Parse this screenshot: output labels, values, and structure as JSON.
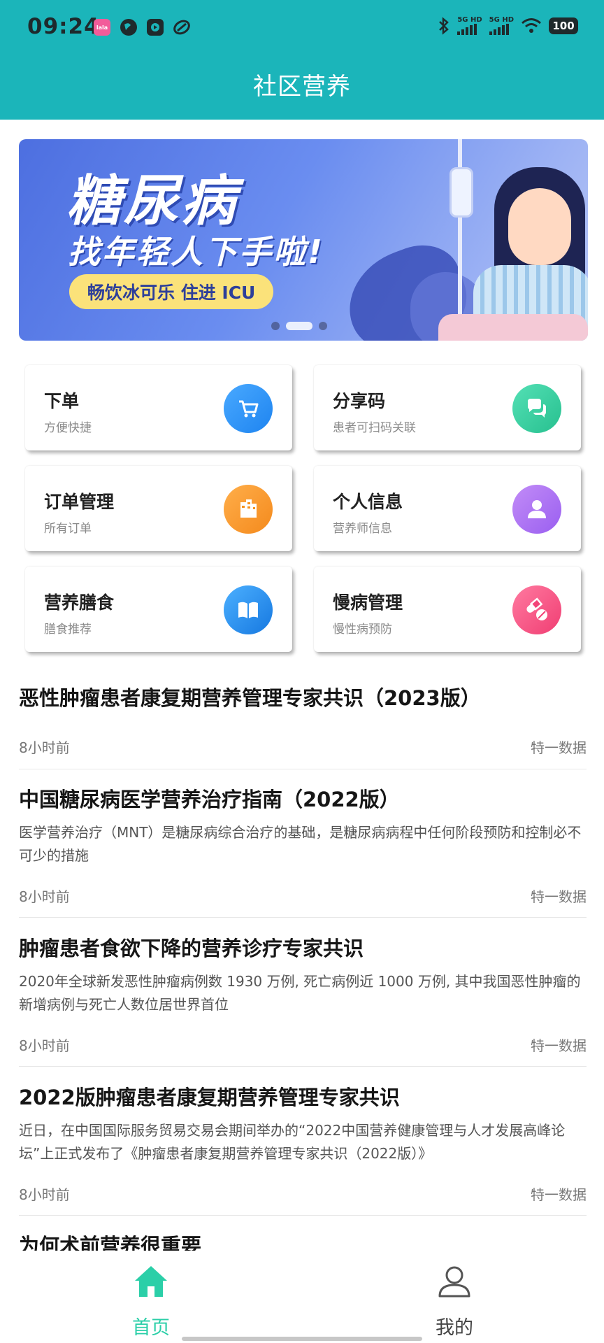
{
  "status_bar": {
    "time": "09:24",
    "app_icons": [
      "lala-app-icon",
      "globe-app-icon",
      "video-app-icon",
      "leaf-app-icon"
    ],
    "network_1": "5G HD",
    "network_2": "5G HD",
    "battery": "100"
  },
  "header": {
    "title": "社区营养",
    "background_color": "#1BB5BA"
  },
  "banner": {
    "title": "糖尿病",
    "subtitle": "找年轻人下手啦!",
    "pill": "畅饮冰可乐 住进 ICU",
    "active_dot_index": 1,
    "dot_count": 3
  },
  "grid": [
    {
      "title": "下单",
      "subtitle": "方便快捷",
      "icon": "cart-icon",
      "color": "#2A8CF3"
    },
    {
      "title": "分享码",
      "subtitle": "患者可扫码关联",
      "icon": "chat-bubbles-icon",
      "color": "#2DC495"
    },
    {
      "title": "订单管理",
      "subtitle": "所有订单",
      "icon": "building-icon",
      "color": "#F5921F"
    },
    {
      "title": "个人信息",
      "subtitle": "营养师信息",
      "icon": "person-icon",
      "color": "#A066F1"
    },
    {
      "title": "营养膳食",
      "subtitle": "膳食推荐",
      "icon": "book-icon",
      "color": "#1D82E6"
    },
    {
      "title": "慢病管理",
      "subtitle": "慢性病预防",
      "icon": "pill-icon",
      "color": "#F24478"
    }
  ],
  "news": [
    {
      "title": "恶性肿瘤患者康复期营养管理专家共识（2023版）",
      "desc": "",
      "time": "8小时前",
      "source": "特一数据"
    },
    {
      "title": "中国糖尿病医学营养治疗指南（2022版）",
      "desc": "医学营养治疗（MNT）是糖尿病综合治疗的基础，是糖尿病病程中任何阶段预防和控制必不可少的措施",
      "time": "8小时前",
      "source": "特一数据"
    },
    {
      "title": "肿瘤患者食欲下降的营养诊疗专家共识",
      "desc": "2020年全球新发恶性肿瘤病例数 1930 万例, 死亡病例近 1000 万例, 其中我国恶性肿瘤的新增病例与死亡人数位居世界首位",
      "time": "8小时前",
      "source": "特一数据"
    },
    {
      "title": "2022版肿瘤患者康复期营养管理专家共识",
      "desc": "近日，在中国国际服务贸易交易会期间举办的“2022中国营养健康管理与人才发展高峰论坛”上正式发布了《肿瘤患者康复期营养管理专家共识（2022版）》",
      "time": "8小时前",
      "source": "特一数据"
    },
    {
      "title": "为何术前营养很重要",
      "desc": "",
      "time": "",
      "source": ""
    }
  ],
  "tabbar": {
    "home_label": "首页",
    "mine_label": "我的",
    "active_color": "#2BCFA8",
    "inactive_color": "#444444"
  }
}
